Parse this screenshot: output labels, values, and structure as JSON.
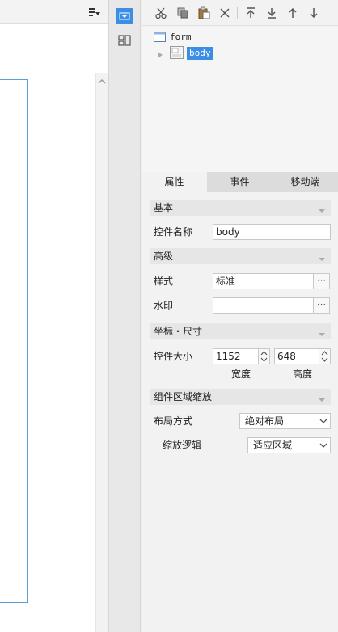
{
  "tree": {
    "root_label": "form",
    "child_label": "body"
  },
  "tabs": [
    {
      "label": "属性"
    },
    {
      "label": "事件"
    },
    {
      "label": "移动端"
    }
  ],
  "sections": {
    "basic": "基本",
    "advanced": "高级",
    "coords": "坐标・尺寸",
    "scaling": "组件区域缩放"
  },
  "props": {
    "control_name_label": "控件名称",
    "control_name_value": "body",
    "style_label": "样式",
    "style_value": "标准",
    "style_dots": "···",
    "watermark_label": "水印",
    "watermark_value": "",
    "watermark_dots": "···",
    "size_label": "控件大小",
    "width_value": "1152",
    "height_value": "648",
    "width_caption": "宽度",
    "height_caption": "高度",
    "layout_label": "布局方式",
    "layout_value": "绝对布局",
    "scale_label": "缩放逻辑",
    "scale_value": "适应区域"
  },
  "colors": {
    "accent": "#3a8ee6",
    "frame_border": "#5aa0d8"
  },
  "icons": [
    "cut-icon",
    "copy-icon",
    "paste-icon",
    "delete-icon",
    "move-top-icon",
    "move-bottom-icon",
    "move-up-icon",
    "move-down-icon"
  ]
}
